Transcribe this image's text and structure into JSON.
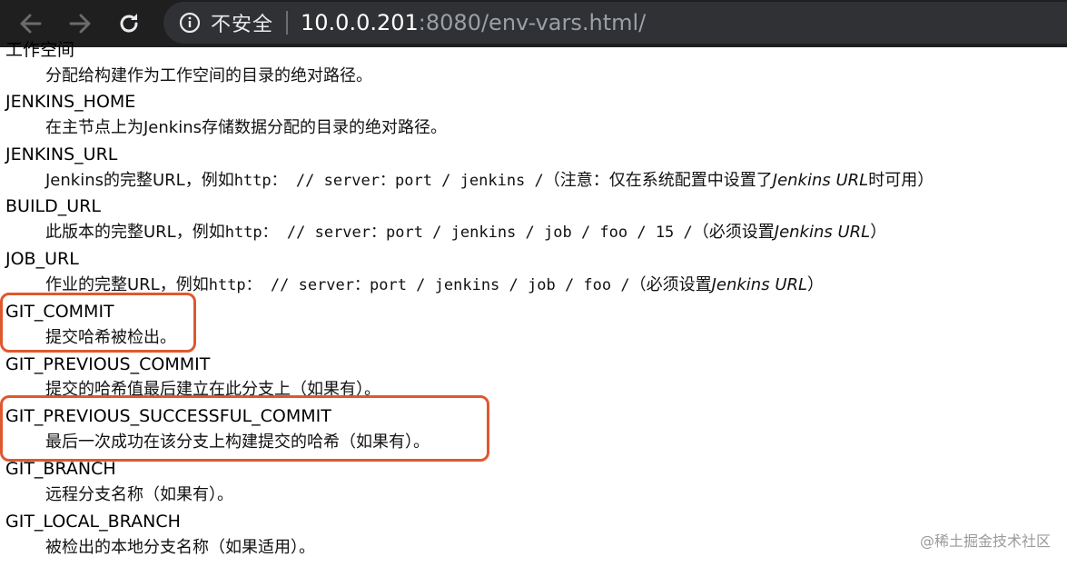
{
  "browser": {
    "security_label": "不安全",
    "url_host": "10.0.0.201",
    "url_rest": ":8080/env-vars.html/"
  },
  "entries": [
    {
      "name": "工作空间",
      "desc": "分配给构建作为工作空间的目录的绝对路径。"
    },
    {
      "name": "JENKINS_HOME",
      "desc": "在主节点上为Jenkins存储数据分配的目录的绝对路径。"
    },
    {
      "name": "JENKINS_URL",
      "desc_prefix": "Jenkins的完整URL，例如",
      "desc_mono": "http： // server：port / jenkins /",
      "desc_suffix_a": "（注意：仅在系统配置中设置了",
      "desc_em": "Jenkins URL",
      "desc_suffix_b": "时可用）"
    },
    {
      "name": "BUILD_URL",
      "desc_prefix": "此版本的完整URL，例如",
      "desc_mono": "http： // server：port / jenkins / job / foo / 15 /",
      "desc_suffix_a": "（必须设置",
      "desc_em": "Jenkins URL",
      "desc_suffix_b": "）"
    },
    {
      "name": "JOB_URL",
      "desc_prefix": "作业的完整URL，例如",
      "desc_mono": "http： // server：port / jenkins / job / foo /",
      "desc_suffix_a": "（必须设置",
      "desc_em": "Jenkins URL",
      "desc_suffix_b": "）"
    },
    {
      "name": "GIT_COMMIT",
      "desc": "提交哈希被检出。"
    },
    {
      "name": "GIT_PREVIOUS_COMMIT",
      "desc": "提交的哈希值最后建立在此分支上（如果有）。"
    },
    {
      "name": "GIT_PREVIOUS_SUCCESSFUL_COMMIT",
      "desc": "最后一次成功在该分支上构建提交的哈希（如果有）。"
    },
    {
      "name": "GIT_BRANCH",
      "desc": "远程分支名称（如果有）。"
    },
    {
      "name": "GIT_LOCAL_BRANCH",
      "desc": "被检出的本地分支名称（如果适用）。"
    }
  ],
  "watermark": "@稀土掘金技术社区",
  "colors": {
    "highlight": "#e0582d",
    "toolbar": "#1f1f1f",
    "omnibox": "#303134"
  }
}
